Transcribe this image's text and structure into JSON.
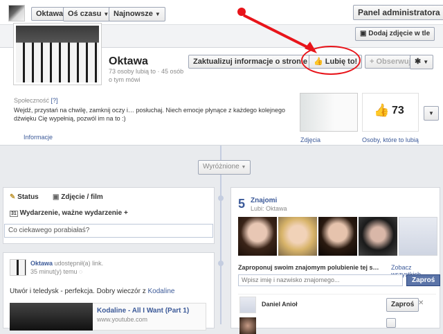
{
  "topbar": {
    "page_name": "Oktawa",
    "tab_since": "Oś czasu",
    "tab_sort": "Najnowsze",
    "admin_panel": "Panel administratora",
    "add_cover": "Dodaj zdjęcie w tle"
  },
  "profile": {
    "name": "Oktawa",
    "likes_line": "73 osoby lubią to · 45 osób",
    "about_line": "o tym mówi",
    "update_info": "Zaktualizuj informacje o stronie",
    "like_button": "Lubię to!",
    "follow_button": "Obserwuj",
    "category": "Społeczność",
    "category_help": "[?]",
    "description": "Wejdź, przystań na chwilę, zamknij oczy i… posłuchaj. Niech emocje płynące z każdego kolejnego dźwięku Cię wypełnią, pozwól im na to :)",
    "info_link": "Informacje",
    "photos_label": "Zdjęcia",
    "likes_count": "73",
    "likes_label": "Osoby, które to lubią"
  },
  "highlight": {
    "label": "Wyróżnione"
  },
  "composer": {
    "status": "Status",
    "photo": "Zdjęcie / film",
    "event": "Wydarzenie, ważne wydarzenie +",
    "placeholder": "Co ciekawego porabiałaś?"
  },
  "post": {
    "author": "Oktawa",
    "action": "udostępnił(a) link.",
    "time": "35 minut(y) temu",
    "text_before": "Utwór i teledysk - perfekcja. Dobry wieczór z",
    "text_link": "Kodaline",
    "link_title": "Kodaline - All I Want (Part 1)",
    "link_url": "www.youtube.com"
  },
  "friends": {
    "count": "5",
    "title": "Znajomi",
    "subtitle": "Lubi: Oktawa",
    "suggest": "Zaproponuj swoim znajomym polubienie tej s…",
    "see_all": "Zobacz wszystkich",
    "search_placeholder": "Wpisz imię i nazwisko znajomego...",
    "invite": "Zaproś",
    "list": [
      {
        "name": "Daniel Anioł",
        "button": "Zaproś"
      }
    ]
  },
  "colors": {
    "annotation": "#e8141a",
    "brand": "#3b5998",
    "like_blue": "#4a6fb5"
  }
}
